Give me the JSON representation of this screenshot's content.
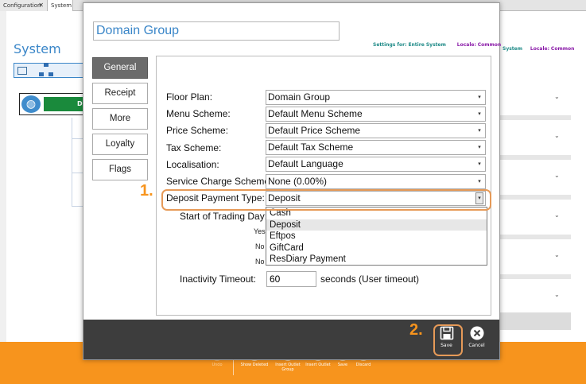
{
  "app": {
    "tabs": [
      {
        "label": "Configuration",
        "closable": true
      },
      {
        "label": "System",
        "closable": false
      }
    ],
    "title": "System",
    "domain_node_label": "Domai",
    "settings_for_label": "Settings for:",
    "settings_for_value": "Entire System",
    "locale_label": "Locale:",
    "locale_value": "Common",
    "bg_partial_system": "System",
    "toolbar": [
      {
        "label": "Undo",
        "enabled": false,
        "icon": "undo-icon"
      },
      {
        "label": "Show Deleted",
        "enabled": true,
        "icon": "eye-icon"
      },
      {
        "label": "Insert Outlet Group",
        "enabled": true,
        "icon": "globe-icon"
      },
      {
        "label": "Insert Outlet",
        "enabled": true,
        "icon": "building-icon"
      },
      {
        "label": "Save",
        "enabled": true,
        "icon": "save-icon"
      },
      {
        "label": "Discard",
        "enabled": true,
        "icon": "discard-icon"
      }
    ]
  },
  "modal": {
    "title": "Domain Group",
    "settings_for_label": "Settings for:",
    "settings_for_value": "Entire System",
    "locale_label": "Locale:",
    "locale_value": "Common",
    "side_tabs": [
      "General",
      "Receipt",
      "More",
      "Loyalty",
      "Flags"
    ],
    "active_tab": "General",
    "fields": {
      "floor_plan": {
        "label": "Floor Plan:",
        "value": "Domain Group"
      },
      "menu_scheme": {
        "label": "Menu Scheme:",
        "value": "Default Menu Scheme"
      },
      "price_scheme": {
        "label": "Price Scheme:",
        "value": "Default Price Scheme"
      },
      "tax_scheme": {
        "label": "Tax Scheme:",
        "value": "Default Tax Scheme"
      },
      "localisation": {
        "label": "Localisation:",
        "value": "Default Language"
      },
      "service_charge_scheme": {
        "label": "Service Charge Scheme:",
        "value": "None (0.00%)"
      },
      "deposit_payment_type": {
        "label": "Deposit Payment Type:",
        "value": "Deposit"
      },
      "start_of_trading_day": {
        "label": "Start of Trading Day:"
      },
      "inactivity_timeout": {
        "label": "Inactivity Timeout:",
        "value": "60",
        "suffix": "seconds (User timeout)"
      }
    },
    "deposit_options": [
      "Cash",
      "Deposit",
      "Eftpos",
      "GiftCard",
      "ResDiary Payment"
    ],
    "highlighted_option": "Deposit",
    "partial_rows": [
      "Yes",
      "No",
      "No"
    ],
    "footer": {
      "save_label": "Save",
      "cancel_label": "Cancel"
    }
  },
  "annotations": {
    "step1": "1.",
    "step2": "2."
  },
  "colors": {
    "accent_orange": "#f7941d",
    "title_blue": "#3a86c8",
    "footer_dark": "#3d3d3d",
    "node_green": "#1a8a3c"
  }
}
